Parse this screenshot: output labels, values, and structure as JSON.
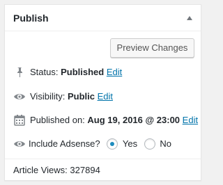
{
  "panel": {
    "title": "Publish",
    "toggle_icon": "triangle-up-icon"
  },
  "actions": {
    "preview_label": "Preview Changes"
  },
  "status": {
    "icon": "pin-icon",
    "label": "Status:",
    "value": "Published",
    "edit_label": "Edit"
  },
  "visibility": {
    "icon": "eye-icon",
    "label": "Visibility:",
    "value": "Public",
    "edit_label": "Edit"
  },
  "published_on": {
    "icon": "calendar-icon",
    "label": "Published on:",
    "value": "Aug 19, 2016 @ 23:00",
    "edit_label": "Edit"
  },
  "adsense": {
    "icon": "eye-icon",
    "label": "Include Adsense?",
    "options": [
      {
        "label": "Yes",
        "checked": true
      },
      {
        "label": "No",
        "checked": false
      }
    ]
  },
  "stats": {
    "article_views_label": "Article Views:",
    "article_views_value": "327894"
  },
  "colors": {
    "link": "#0073aa",
    "icon": "#82878c",
    "radio_checked": "#1e8cbe"
  }
}
